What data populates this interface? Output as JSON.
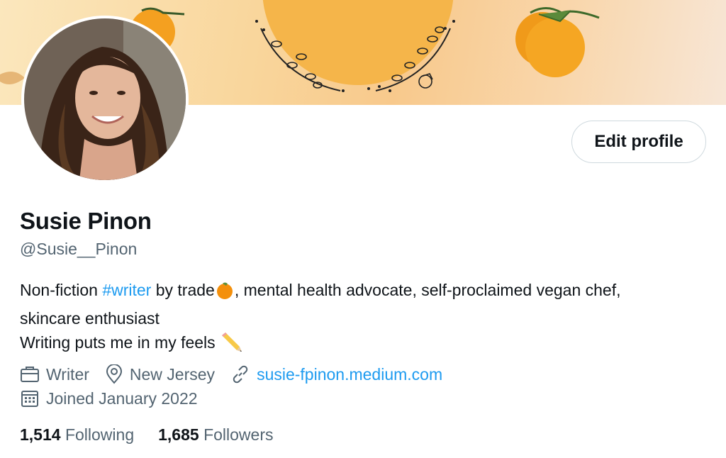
{
  "profile": {
    "name": "Susie Pinon",
    "handle": "@Susie__Pinon",
    "edit_label": "Edit profile"
  },
  "bio": {
    "part1": "Non-fiction ",
    "hashtag": "#writer",
    "part2": " by trade",
    "part3": ", mental health advocate, self-proclaimed vegan chef,",
    "line2": "skincare enthusiast",
    "line3": "Writing puts me in my feels ",
    "emoji1": "orange-emoji",
    "emoji2": "pencil-emoji"
  },
  "meta": {
    "profession": "Writer",
    "location": "New Jersey",
    "website": "susie-fpinon.medium.com",
    "joined": "Joined January 2022"
  },
  "stats": {
    "following_count": "1,514",
    "following_label": "Following",
    "followers_count": "1,685",
    "followers_label": "Followers"
  },
  "colors": {
    "link": "#1d9bf0",
    "secondary_text": "#536471",
    "primary_text": "#0f1419",
    "banner_orange": "#f5b54a"
  }
}
